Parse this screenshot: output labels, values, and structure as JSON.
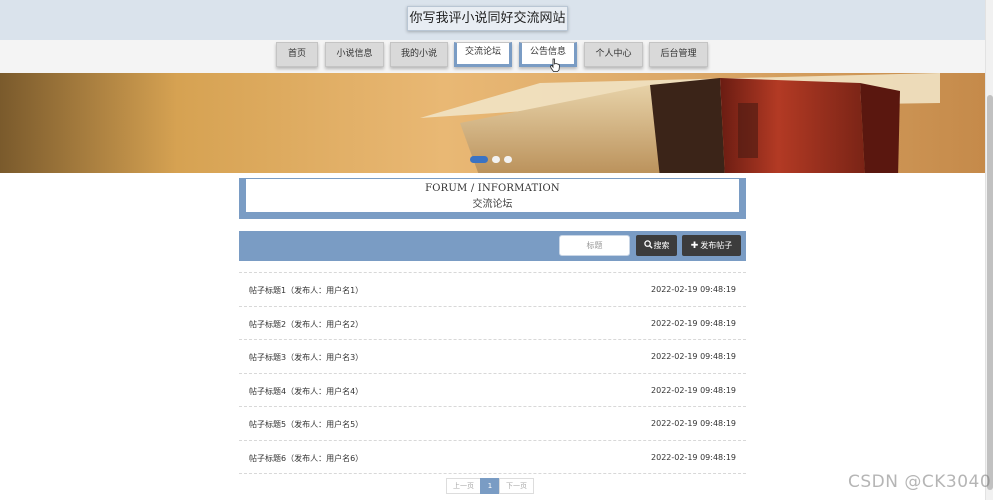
{
  "header": {
    "site_title": "你写我评小说同好交流网站"
  },
  "nav": {
    "items": [
      {
        "label": "首页"
      },
      {
        "label": "小说信息"
      },
      {
        "label": "我的小说"
      },
      {
        "label": "交流论坛"
      },
      {
        "label": "公告信息"
      },
      {
        "label": "个人中心"
      },
      {
        "label": "后台管理"
      }
    ],
    "active_label": "交流论坛"
  },
  "section": {
    "title_en": "FORUM / INFORMATION",
    "title_cn": "交流论坛"
  },
  "search": {
    "placeholder": "标题",
    "search_label": "搜索",
    "post_label": "发布帖子"
  },
  "posts": [
    {
      "title": "帖子标题1（发布人：用户名1）",
      "time": "2022-02-19 09:48:19"
    },
    {
      "title": "帖子标题2（发布人：用户名2）",
      "time": "2022-02-19 09:48:19"
    },
    {
      "title": "帖子标题3（发布人：用户名3）",
      "time": "2022-02-19 09:48:19"
    },
    {
      "title": "帖子标题4（发布人：用户名4）",
      "time": "2022-02-19 09:48:19"
    },
    {
      "title": "帖子标题5（发布人：用户名5）",
      "time": "2022-02-19 09:48:19"
    },
    {
      "title": "帖子标题6（发布人：用户名6）",
      "time": "2022-02-19 09:48:19"
    }
  ],
  "pagination": {
    "prev_label": "上一页",
    "current_page": "1",
    "next_label": "下一页"
  },
  "watermark": "CSDN @CK3040",
  "colors": {
    "accent": "#7a9cc4",
    "header_bg": "#dae3ec",
    "button_dark": "#3c3c3c"
  }
}
